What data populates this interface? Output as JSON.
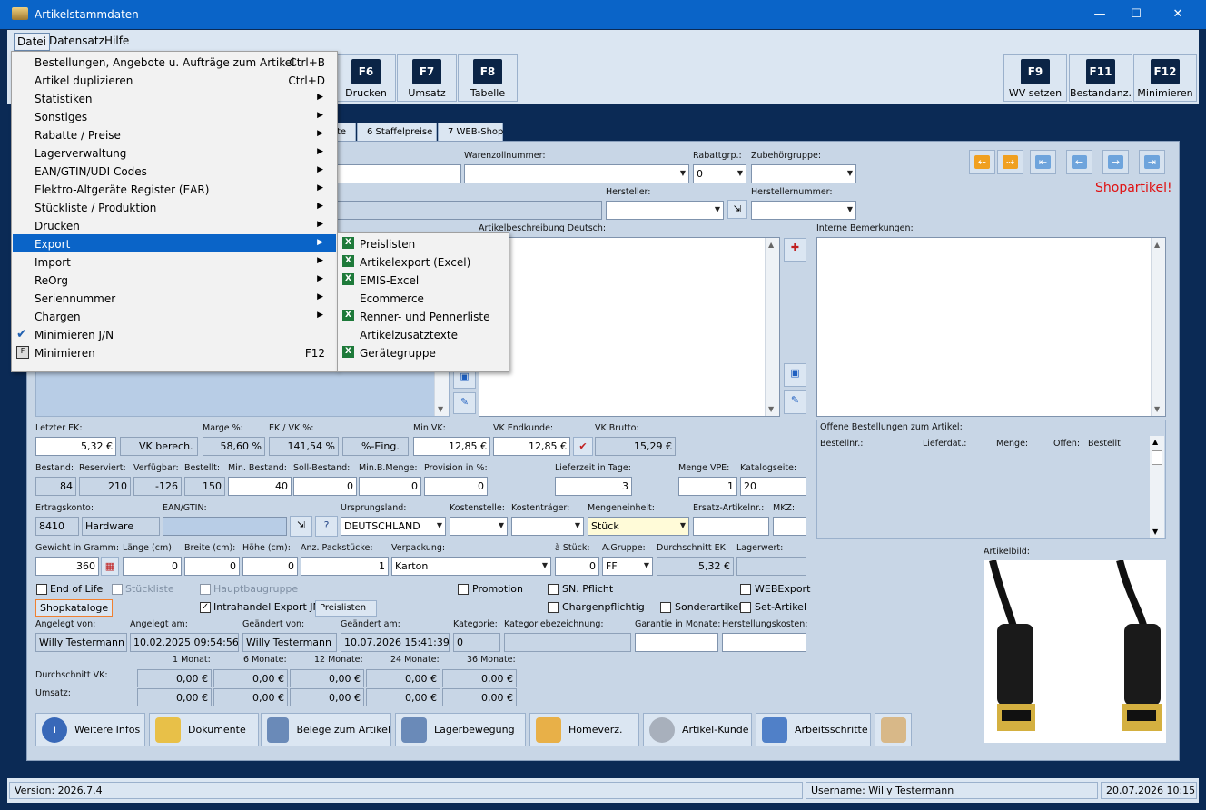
{
  "window": {
    "title": "Artikelstammdaten"
  },
  "menubar": {
    "items": [
      "Datei",
      "Datensatz",
      "Hilfe"
    ]
  },
  "toolbar": {
    "buttons": [
      {
        "key": "F6",
        "label": "Drucken"
      },
      {
        "key": "F7",
        "label": "Umsatz"
      },
      {
        "key": "F8",
        "label": "Tabelle"
      },
      {
        "key": "F9",
        "label": "WV setzen"
      },
      {
        "key": "F11",
        "label": "Bestandanz."
      },
      {
        "key": "F12",
        "label": "Minimieren"
      }
    ]
  },
  "tabs": [
    {
      "label": "te"
    },
    {
      "label": "6 Staffelpreise"
    },
    {
      "label": "7 WEB-Shop"
    }
  ],
  "shop_notice": "Shopartikel!",
  "labels": {
    "warenzollnummer": "Warenzollnummer:",
    "rabattgrp": "Rabattgrp.:",
    "zubehoergruppe": "Zubehörgruppe:",
    "hersteller": "Hersteller:",
    "herstellernummer": "Herstellernummer:",
    "beschreibung": "Artikelbeschreibung Deutsch:",
    "bemerkungen": "Interne Bemerkungen:",
    "letzter_ek": "Letzter EK:",
    "marge": "Marge %:",
    "ek_vk": "EK / VK %:",
    "min_vk": "Min VK:",
    "vk_endkunde": "VK Endkunde:",
    "vk_brutto": "VK Brutto:",
    "bestand": "Bestand:",
    "reserviert": "Reserviert:",
    "verfuegbar": "Verfügbar:",
    "bestellt": "Bestellt:",
    "min_bestand": "Min. Bestand:",
    "soll_bestand": "Soll-Bestand:",
    "min_b_menge": "Min.B.Menge:",
    "provision": "Provision in %:",
    "lieferzeit": "Lieferzeit in Tage:",
    "menge_vpe": "Menge VPE:",
    "katalogseite": "Katalogseite:",
    "ertragskonto": "Ertragskonto:",
    "ean": "EAN/GTIN:",
    "ursprungsland": "Ursprungsland:",
    "kostenstelle": "Kostenstelle:",
    "kostentraeger": "Kostenträger:",
    "mengeneinheit": "Mengeneinheit:",
    "ersatz": "Ersatz-Artikelnr.:",
    "mkz": "MKZ:",
    "gewicht": "Gewicht in Gramm:",
    "laenge": "Länge (cm):",
    "breite": "Breite (cm):",
    "hoehe": "Höhe (cm):",
    "packstuecke": "Anz. Packstücke:",
    "verpackung": "Verpackung:",
    "a_stueck": "à Stück:",
    "a_gruppe": "A.Gruppe:",
    "durchschnitt_ek": "Durchschnitt EK:",
    "lagerwert": "Lagerwert:",
    "angelegt_von": "Angelegt von:",
    "angelegt_am": "Angelegt am:",
    "geaendert_von": "Geändert von:",
    "geaendert_am": "Geändert am:",
    "kategorie": "Kategorie:",
    "kategoriebez": "Kategoriebezeichnung:",
    "garantie": "Garantie in Monate:",
    "herstellkosten": "Herstellungskosten:",
    "durchschnitt_vk": "Durchschnitt VK:",
    "umsatz": "Umsatz:",
    "offene_bestellungen": "Offene Bestellungen zum Artikel:",
    "artikelbild": "Artikelbild:"
  },
  "values": {
    "rabattgrp": "0",
    "letzter_ek": "5,32 €",
    "vk_berech": "VK berech.",
    "marge": "58,60 %",
    "ek_vk": "141,54 %",
    "pct_eing": "%-Eing.",
    "min_vk": "12,85 €",
    "vk_endkunde": "12,85 €",
    "vk_brutto": "15,29 €",
    "bestand": "84",
    "reserviert": "210",
    "verfuegbar": "-126",
    "bestellt": "150",
    "min_bestand": "40",
    "soll_bestand": "0",
    "min_b_menge": "0",
    "provision": "0",
    "lieferzeit": "3",
    "menge_vpe": "1",
    "katalogseite": "20",
    "ertragskonto_nr": "8410",
    "ertragskonto_name": "Hardware",
    "ursprungsland": "DEUTSCHLAND",
    "mengeneinheit": "Stück",
    "gewicht": "360",
    "laenge": "0",
    "breite": "0",
    "hoehe": "0",
    "packstuecke": "1",
    "verpackung": "Karton",
    "a_stueck": "0",
    "a_gruppe": "FF",
    "durchschnitt_ek": "5,32 €",
    "angelegt_von": "Willy Testermann",
    "angelegt_am": "10.02.2025 09:54:56",
    "geaendert_von": "Willy Testermann",
    "geaendert_am": "10.07.2026 15:41:39",
    "kategorie": "0"
  },
  "checkboxes": {
    "end_of_life": "End of Life",
    "stueckliste": "Stückliste",
    "hauptbaugruppe": "Hauptbaugruppe",
    "promotion": "Promotion",
    "sn_pflicht": "SN. Pflicht",
    "webexport": "WEBExport",
    "intrahandel": "Intrahandel Export JN",
    "chargenpflichtig": "Chargenpflichtig",
    "sonderartikel": "Sonderartikel",
    "set_artikel": "Set-Artikel"
  },
  "shopkataloge": "Shopkataloge",
  "preislisten_btn": "Preislisten",
  "umsatz_table": {
    "headers": [
      "1 Monat:",
      "6 Monate:",
      "12 Monate:",
      "24 Monate:",
      "36 Monate:"
    ],
    "vk": [
      "0,00 €",
      "0,00 €",
      "0,00 €",
      "0,00 €",
      "0,00 €"
    ],
    "umsatz": [
      "0,00 €",
      "0,00 €",
      "0,00 €",
      "0,00 €",
      "0,00 €"
    ]
  },
  "bestellungen_cols": [
    "Bestellnr.:",
    "Lieferdat.:",
    "Menge:",
    "Offen:",
    "Bestellt"
  ],
  "bottom_buttons": [
    "Weitere Infos",
    "Dokumente",
    "Belege zum Artikel",
    "Lagerbewegung",
    "Homeverz.",
    "Artikel-Kunde",
    "Arbeitsschritte"
  ],
  "statusbar": {
    "version": "Version: 2026.7.4",
    "user": "Username: Willy Testermann",
    "datetime": "20.07.2026 10:15"
  },
  "datei_menu": [
    {
      "label": "Bestellungen, Angebote u. Aufträge zum Artikel",
      "shortcut": "Ctrl+B"
    },
    {
      "label": "Artikel duplizieren",
      "shortcut": "Ctrl+D"
    },
    {
      "label": "Statistiken",
      "sub": true
    },
    {
      "label": "Sonstiges",
      "sub": true
    },
    {
      "label": "Rabatte / Preise",
      "sub": true
    },
    {
      "label": "Lagerverwaltung",
      "sub": true
    },
    {
      "label": "EAN/GTIN/UDI Codes",
      "sub": true
    },
    {
      "label": "Elektro-Altgeräte Register (EAR)",
      "sub": true
    },
    {
      "label": "Stückliste / Produktion",
      "sub": true
    },
    {
      "label": "Drucken",
      "sub": true
    },
    {
      "label": "Export",
      "sub": true,
      "selected": true
    },
    {
      "label": "Import",
      "sub": true
    },
    {
      "label": "ReOrg",
      "sub": true
    },
    {
      "label": "Seriennummer",
      "sub": true
    },
    {
      "label": "Chargen",
      "sub": true
    },
    {
      "label": "Minimieren J/N",
      "checked": true
    },
    {
      "label": "Minimieren",
      "shortcut": "F12"
    }
  ],
  "export_submenu": [
    {
      "label": "Preislisten",
      "icon": true
    },
    {
      "label": "Artikelexport (Excel)",
      "icon": true
    },
    {
      "label": "EMIS-Excel",
      "icon": true
    },
    {
      "label": "Ecommerce",
      "icon": false
    },
    {
      "label": "Renner- und Pennerliste",
      "icon": true
    },
    {
      "label": "Artikelzusatztexte",
      "icon": false
    },
    {
      "label": "Gerätegruppe",
      "icon": true
    }
  ]
}
